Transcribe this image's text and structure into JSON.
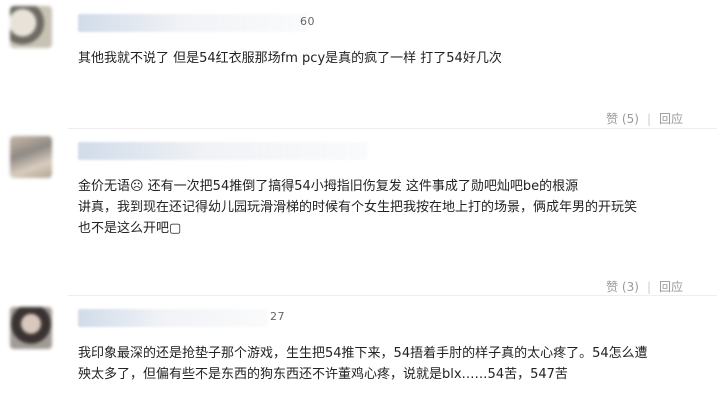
{
  "comments": [
    {
      "name_suffix": "60",
      "lines": [
        "其他我就不说了 但是54红衣服那场fm pcy是真的疯了一样 打了54好几次"
      ],
      "like_label": "赞 (5)",
      "reply_label": "回应"
    },
    {
      "name_suffix": "",
      "lines": [
        "金价无语☹ 还有一次把54推倒了搞得54小拇指旧伤复发 这件事成了勋吧灿吧be的根源",
        "讲真，我到现在还记得幼儿园玩滑滑梯的时候有个女生把我按在地上打的场景，俩成年男的开玩笑",
        "也不是这么开吧▢"
      ],
      "like_label": "赞 (3)",
      "reply_label": "回应"
    },
    {
      "name_suffix": "27",
      "lines": [
        "我印象最深的还是抢垫子那个游戏，生生把54推下来，54捂着手肘的样子真的太心疼了。54怎么遭",
        "殃太多了，但偏有些不是东西的狗东西还不许董鸡心疼，说就是blx……54苦，547苦"
      ]
    }
  ]
}
